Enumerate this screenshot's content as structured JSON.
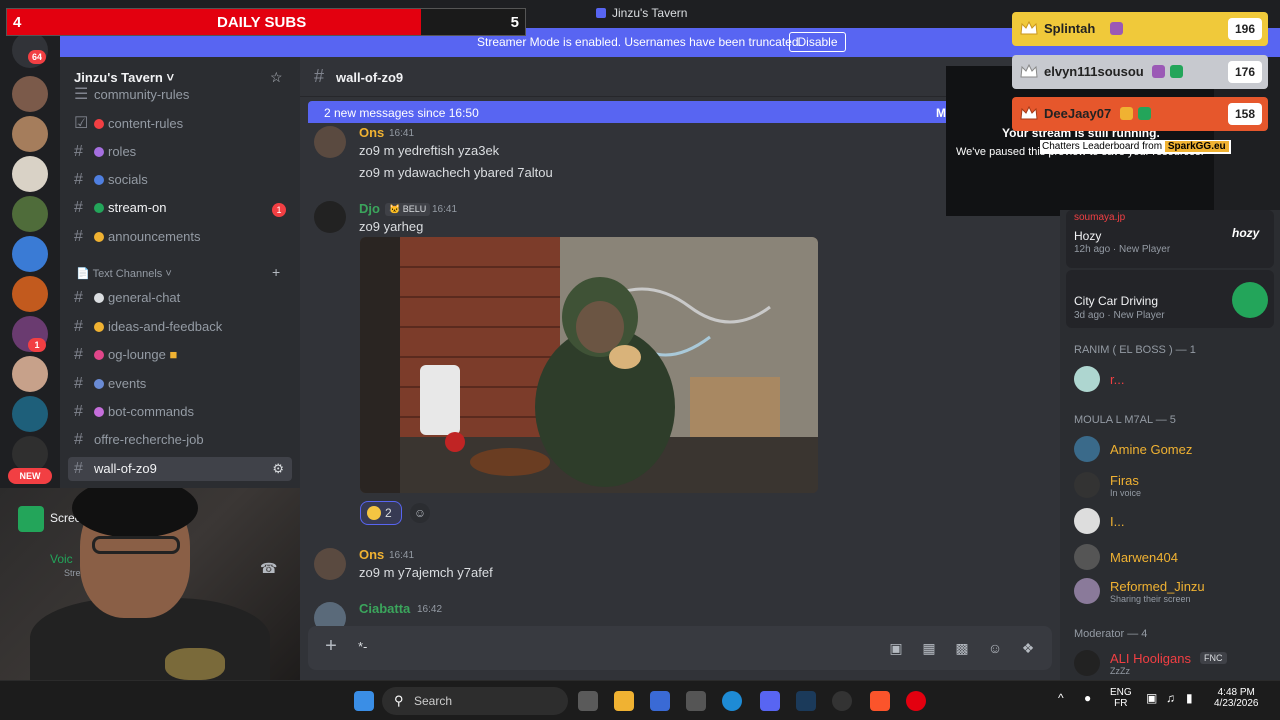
{
  "window": {
    "title": "Jinzu's Tavern"
  },
  "banner": {
    "text": "Streamer Mode is enabled. Usernames have been truncated.",
    "disable_label": "Disable"
  },
  "daily_subs": {
    "left": "4",
    "label": "DAILY SUBS",
    "right": "5",
    "progress": 0.8
  },
  "rail": {
    "badge_64": "64",
    "badge_1": "1",
    "new_label": "NEW"
  },
  "server": {
    "name": "Jinzu's Tavern"
  },
  "channels": {
    "top": [
      {
        "label": "community-rules"
      },
      {
        "label": "content-rules"
      },
      {
        "label": "roles"
      },
      {
        "label": "socials"
      },
      {
        "label": "stream-on",
        "unread": "1"
      },
      {
        "label": "announcements"
      }
    ],
    "category": "Text Channels",
    "text": [
      {
        "label": "general-chat"
      },
      {
        "label": "ideas-and-feedback"
      },
      {
        "label": "og-lounge"
      },
      {
        "label": "events"
      },
      {
        "label": "bot-commands"
      },
      {
        "label": "offre-recherche-job"
      },
      {
        "label": "wall-of-zo9"
      }
    ]
  },
  "voice": {
    "screen_label": "Screen",
    "voice_label": "Voic",
    "voice_sub": "Stre"
  },
  "chat": {
    "channel": "wall-of-zo9",
    "new_messages": "2 new messages since 16:50",
    "new_messages_right": "M",
    "messages": [
      {
        "user": "Ons",
        "time": "16:41",
        "lines": [
          "zo9 m yedreftish yza3ek",
          "zo9 m ydawachech ybared 7altou"
        ]
      },
      {
        "user": "Djo",
        "tag": "BELU",
        "time": "16:41",
        "lines": [
          "zo9 yarheg"
        ]
      },
      {
        "user": "Ons",
        "time": "16:41",
        "lines": [
          "zo9 m y7ajemch y7afef"
        ]
      },
      {
        "user": "Ciabatta",
        "time": "16:42",
        "lines": []
      }
    ],
    "reaction_count": "2",
    "composer_text": "*-"
  },
  "stream_overlay": {
    "title": "Your stream is still running.",
    "body": "We've paused this preview to save your resources."
  },
  "leaderboard": {
    "entries": [
      {
        "name": "Splintah",
        "score": "196"
      },
      {
        "name": "elvyn111sousou",
        "score": "176"
      },
      {
        "name": "DeeJaay07",
        "score": "158"
      }
    ],
    "footer": "Chatters Leaderboard from",
    "footer_brand": "SparkGG.eu"
  },
  "members": {
    "activity_cards": [
      {
        "user": "soumaya.jp",
        "game": "Hozy",
        "time": "12h ago",
        "status": "New Player",
        "logo": "hozy"
      },
      {
        "user": "",
        "game": "City Car Driving",
        "time": "3d ago",
        "status": "New Player"
      }
    ],
    "groups": [
      {
        "header": "RANIM ( EL BOSS ) — 1",
        "members": [
          {
            "name": "r..."
          }
        ]
      },
      {
        "header": "MOULA L M7AL — 5",
        "members": [
          {
            "name": "Amine Gomez"
          },
          {
            "name": "Firas",
            "status": "In voice"
          },
          {
            "name": "I..."
          },
          {
            "name": "Marwen404"
          },
          {
            "name": "Reformed_Jinzu",
            "status": "Sharing their screen"
          }
        ]
      },
      {
        "header": "Moderator — 4",
        "members": [
          {
            "name": "ALI Hooligans",
            "tag": "FNC",
            "status": "ZzZz"
          }
        ]
      }
    ]
  },
  "taskbar": {
    "search": "Search",
    "lang1": "ENG",
    "lang2": "FR",
    "time": "4:48 PM",
    "date": "4/23/2026"
  },
  "colors": {
    "accent": "#5865f2",
    "danger": "#f23f43",
    "subs_red": "#e3000f",
    "gold": "#f0b232"
  }
}
